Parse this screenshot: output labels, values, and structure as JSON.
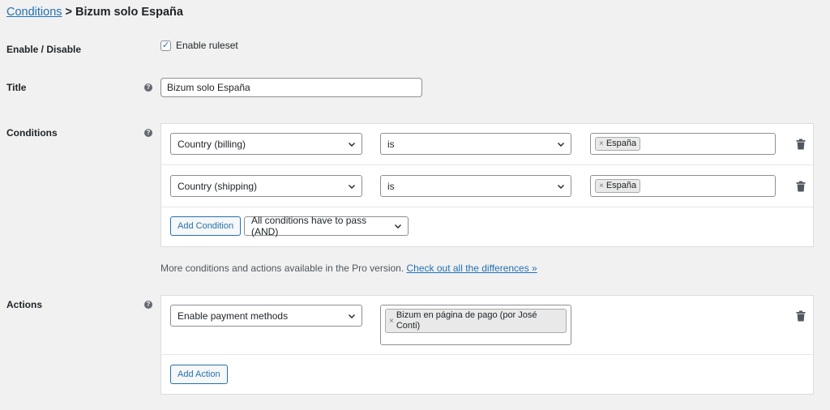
{
  "breadcrumb": {
    "link": "Conditions",
    "separator": ">",
    "current": "Bizum solo España"
  },
  "enable": {
    "label": "Enable / Disable",
    "checkbox_label": "Enable ruleset",
    "checked": true
  },
  "title_field": {
    "label": "Title",
    "value": "Bizum solo España"
  },
  "conditions": {
    "label": "Conditions",
    "rows": [
      {
        "field": "Country (billing)",
        "operator": "is",
        "values": [
          "España"
        ]
      },
      {
        "field": "Country (shipping)",
        "operator": "is",
        "values": [
          "España"
        ]
      }
    ],
    "add_button": "Add Condition",
    "logic": "All conditions have to pass (AND)"
  },
  "pro_note": {
    "text": "More conditions and actions available in the Pro version.",
    "link": "Check out all the differences »"
  },
  "actions": {
    "label": "Actions",
    "rows": [
      {
        "action": "Enable payment methods",
        "values": [
          "Bizum en página de pago (por José Conti)"
        ]
      }
    ],
    "add_button": "Add Action"
  },
  "icons": {
    "help": "help-icon",
    "trash": "trash-icon",
    "chevron": "chevron-down-icon",
    "check": "check-icon"
  },
  "colors": {
    "accent": "#2271b1",
    "background": "#f1f1f1",
    "panel": "#ffffff"
  }
}
